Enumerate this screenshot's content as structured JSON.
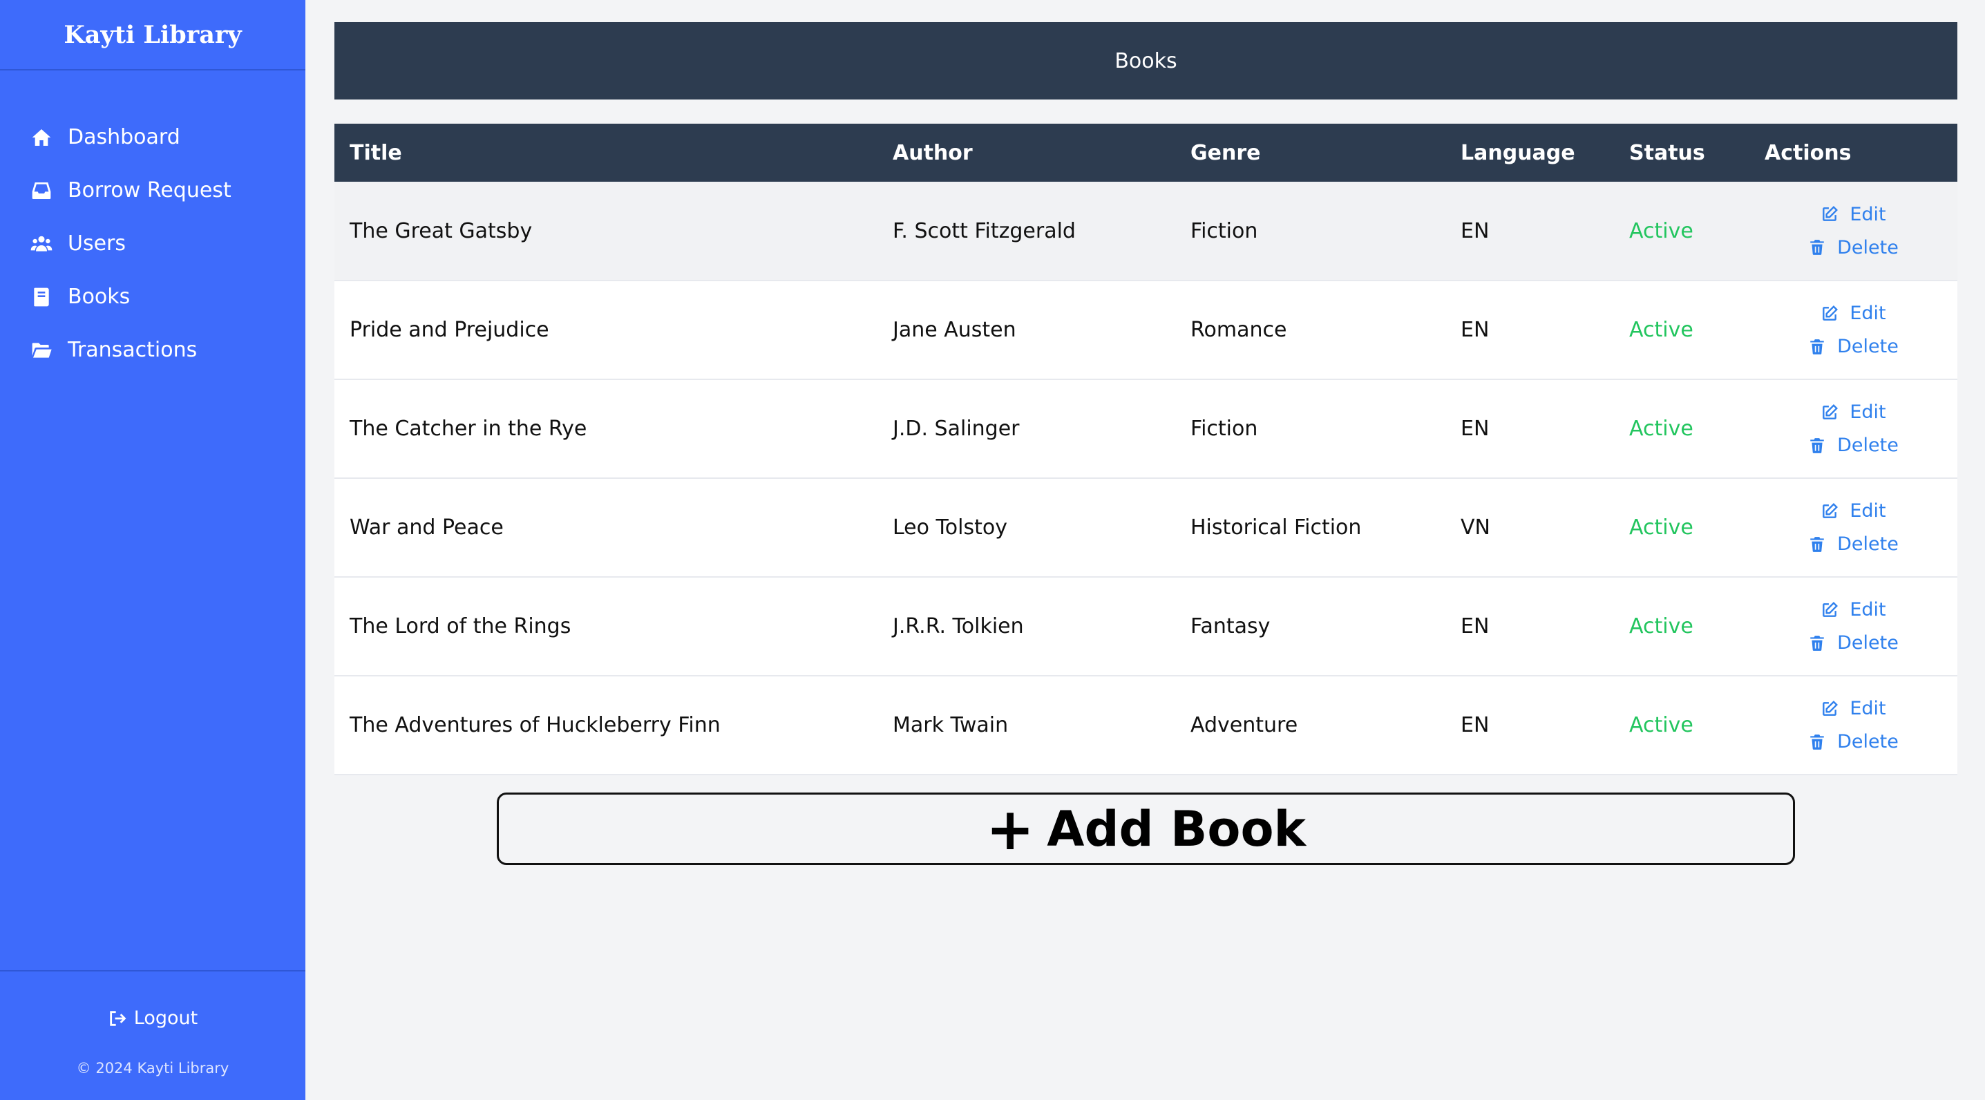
{
  "sidebar": {
    "brand": "Kayti Library",
    "items": [
      {
        "label": "Dashboard",
        "icon": "home-icon"
      },
      {
        "label": "Borrow Request",
        "icon": "inbox-icon"
      },
      {
        "label": "Users",
        "icon": "users-icon"
      },
      {
        "label": "Books",
        "icon": "book-icon"
      },
      {
        "label": "Transactions",
        "icon": "folder-open-icon"
      }
    ],
    "logout_label": "Logout",
    "copyright": "© 2024 Kayti Library"
  },
  "header": {
    "title": "Books"
  },
  "table": {
    "columns": [
      "Title",
      "Author",
      "Genre",
      "Language",
      "Status",
      "Actions"
    ],
    "rows": [
      {
        "title": "The Great Gatsby",
        "author": "F. Scott Fitzgerald",
        "genre": "Fiction",
        "language": "EN",
        "status": "Active"
      },
      {
        "title": "Pride and Prejudice",
        "author": "Jane Austen",
        "genre": "Romance",
        "language": "EN",
        "status": "Active"
      },
      {
        "title": "The Catcher in the Rye",
        "author": "J.D. Salinger",
        "genre": "Fiction",
        "language": "EN",
        "status": "Active"
      },
      {
        "title": "War and Peace",
        "author": "Leo Tolstoy",
        "genre": "Historical Fiction",
        "language": "VN",
        "status": "Active"
      },
      {
        "title": "The Lord of the Rings",
        "author": "J.R.R. Tolkien",
        "genre": "Fantasy",
        "language": "EN",
        "status": "Active"
      },
      {
        "title": "The Adventures of Huckleberry Finn",
        "author": "Mark Twain",
        "genre": "Adventure",
        "language": "EN",
        "status": "Active"
      }
    ],
    "edit_label": "Edit",
    "delete_label": "Delete"
  },
  "add_button": {
    "plus": "+",
    "label": "Add Book"
  },
  "colors": {
    "sidebar": "#3e6bfb",
    "header": "#2d3c50",
    "status_active": "#22c55e",
    "action_link": "#2f80ed"
  }
}
